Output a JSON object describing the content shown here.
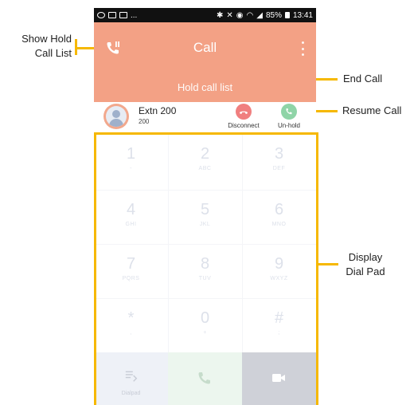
{
  "annotations": {
    "show_hold_line1": "Show Hold",
    "show_hold_line2": "Call List",
    "end_call": "End Call",
    "resume_call": "Resume Call",
    "display_line1": "Display",
    "display_line2": "Dial Pad"
  },
  "statusbar": {
    "dots": "...",
    "battery": "85%",
    "time": "13:41"
  },
  "header": {
    "title": "Call",
    "hold_list_label": "Hold call list"
  },
  "held_call": {
    "name": "Extn 200",
    "number": "200",
    "disconnect_label": "Disconnect",
    "unhold_label": "Un-hold"
  },
  "dialpad": {
    "keys": [
      {
        "digit": "1",
        "letters": "-"
      },
      {
        "digit": "2",
        "letters": "ABC"
      },
      {
        "digit": "3",
        "letters": "DEF"
      },
      {
        "digit": "4",
        "letters": "GHI"
      },
      {
        "digit": "5",
        "letters": "JKL"
      },
      {
        "digit": "6",
        "letters": "MNO"
      },
      {
        "digit": "7",
        "letters": "PQRS"
      },
      {
        "digit": "8",
        "letters": "TUV"
      },
      {
        "digit": "9",
        "letters": "WXYZ"
      },
      {
        "digit": "*",
        "letters": ","
      },
      {
        "digit": "0",
        "letters": "+"
      },
      {
        "digit": "#",
        "letters": ";"
      }
    ],
    "bottom_pad_label": "Dialpad"
  },
  "colors": {
    "header_bg": "#f3a185",
    "annotation": "#f6b800",
    "disconnect": "#f07f7f",
    "unhold": "#8fd4a7"
  }
}
